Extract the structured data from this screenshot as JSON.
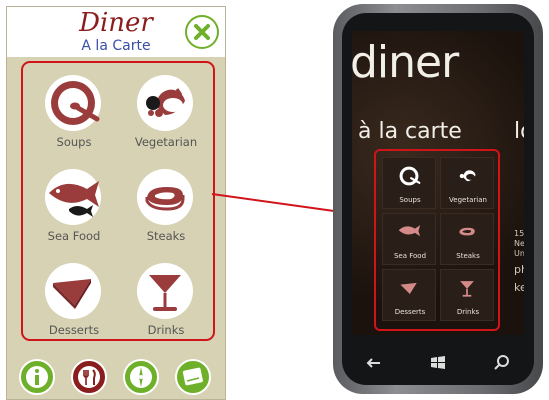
{
  "app": {
    "title": "Diner",
    "subtitle": "A la Carte",
    "close_icon": "close-x-icon",
    "menu": [
      {
        "label": "Soups",
        "icon": "soup-bowl-icon"
      },
      {
        "label": "Vegetarian",
        "icon": "vegetables-icon"
      },
      {
        "label": "Sea Food",
        "icon": "fish-icon"
      },
      {
        "label": "Steaks",
        "icon": "steak-icon"
      },
      {
        "label": "Desserts",
        "icon": "cake-slice-icon"
      },
      {
        "label": "Drinks",
        "icon": "cocktail-glass-icon"
      }
    ],
    "bottom_bar": [
      {
        "icon": "info-icon"
      },
      {
        "icon": "fork-knife-icon"
      },
      {
        "icon": "compass-icon"
      },
      {
        "icon": "note-icon"
      }
    ]
  },
  "phone": {
    "title": "diner",
    "subtitle": "à la carte",
    "next_panel_peek": "lo",
    "side_peek": [
      "15",
      "Ne",
      "Un",
      "ph",
      "ke"
    ],
    "tiles": [
      {
        "label": "Soups"
      },
      {
        "label": "Vegetarian"
      },
      {
        "label": "Sea Food"
      },
      {
        "label": "Steaks"
      },
      {
        "label": "Desserts"
      },
      {
        "label": "Drinks"
      }
    ],
    "hardware_buttons": [
      "back-arrow-icon",
      "windows-logo-icon",
      "search-icon"
    ]
  },
  "colors": {
    "accent_red": "#d1131a",
    "brand_maroon": "#8a1d1d",
    "icon_maroon": "#9a3c3c",
    "green": "#6fb02a",
    "panel_bg": "#d6d2b3"
  }
}
